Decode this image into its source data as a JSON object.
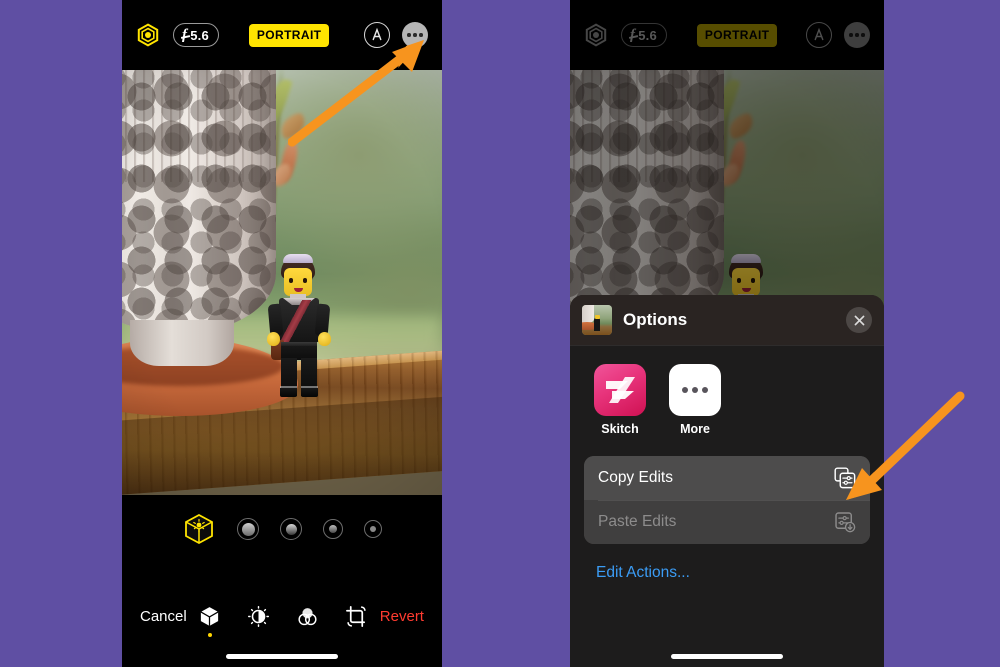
{
  "background_color": "#5f4fa3",
  "accent_arrow_color": "#F7941E",
  "screens": [
    {
      "id": "photo-editor",
      "top_bar": {
        "depth_icon": "hexagon-aperture-icon",
        "aperture_label": "5.6",
        "aperture_prefix": "f",
        "mode_badge": "PORTRAIT",
        "markup_icon": "markup-pen-circle-icon",
        "more_icon": "more-ellipsis-icon"
      },
      "lighting": {
        "selected": "natural-light-cube-icon",
        "options": [
          "studio-light",
          "contour-light",
          "stage-light",
          "stage-light-mono"
        ]
      },
      "toolbar": {
        "cancel_label": "Cancel",
        "revert_label": "Revert",
        "tools": [
          {
            "name": "portrait-depth-tool",
            "icon": "cube-icon",
            "active": true
          },
          {
            "name": "adjust-tool",
            "icon": "brightness-dial-icon",
            "active": false
          },
          {
            "name": "filters-tool",
            "icon": "filters-circles-icon",
            "active": false
          },
          {
            "name": "crop-tool",
            "icon": "crop-rotate-icon",
            "active": false
          }
        ]
      }
    },
    {
      "id": "options-sheet",
      "top_bar": {
        "depth_icon": "hexagon-aperture-icon",
        "aperture_label": "5.6",
        "aperture_prefix": "f",
        "mode_badge": "PORTRAIT",
        "markup_icon": "markup-pen-circle-icon",
        "more_icon": "more-ellipsis-icon"
      },
      "sheet": {
        "title": "Options",
        "thumbnail": "photo-thumbnail",
        "close_icon": "close-x-icon",
        "apps": [
          {
            "label": "Skitch",
            "icon": "skitch-app-icon"
          },
          {
            "label": "More",
            "icon": "more-apps-icon"
          }
        ],
        "actions": [
          {
            "label": "Copy Edits",
            "icon": "copy-edits-icon",
            "enabled": true
          },
          {
            "label": "Paste Edits",
            "icon": "paste-edits-icon",
            "enabled": false
          }
        ],
        "link_label": "Edit Actions..."
      }
    }
  ],
  "annotations": [
    {
      "name": "arrow-to-more-button",
      "points_to": "more-ellipsis-icon"
    },
    {
      "name": "arrow-to-copy-edits",
      "points_to": "copy-edits-icon"
    }
  ]
}
